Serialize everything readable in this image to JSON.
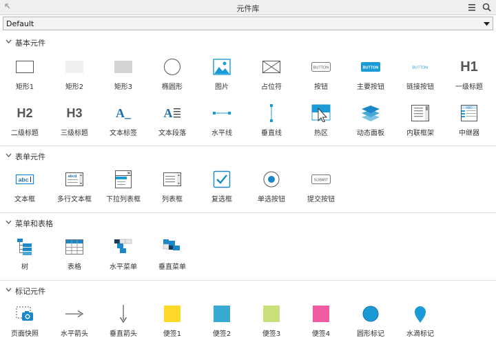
{
  "window": {
    "title": "元件库"
  },
  "library_select": {
    "value": "Default"
  },
  "sections": {
    "basic": {
      "title": "基本元件",
      "items": [
        "矩形1",
        "矩形2",
        "矩形3",
        "椭圆形",
        "图片",
        "占位符",
        "按钮",
        "主要按钮",
        "链接按钮",
        "一级标题",
        "二级标题",
        "三级标题",
        "文本标签",
        "文本段落",
        "水平线",
        "垂直线",
        "热区",
        "动态面板",
        "内联框架",
        "中继器"
      ]
    },
    "form": {
      "title": "表单元件",
      "items": [
        "文本框",
        "多行文本框",
        "下拉列表框",
        "列表框",
        "复选框",
        "单选按钮",
        "提交按钮"
      ]
    },
    "menu": {
      "title": "菜单和表格",
      "items": [
        "树",
        "表格",
        "水平菜单",
        "垂直菜单"
      ]
    },
    "markup": {
      "title": "标记元件",
      "items": [
        "页面快照",
        "水平箭头",
        "垂直箭头",
        "便签1",
        "便签2",
        "便签3",
        "便签4",
        "圆形标记",
        "水滴标记"
      ]
    }
  },
  "icon_text": {
    "button": "BUTTON",
    "primary_button": "BUTTON",
    "link_button": "BUTTON",
    "h1": "H1",
    "h2": "H2",
    "h3": "H3",
    "label": "A_",
    "paragraph": "A",
    "textbox": "abc",
    "textarea": "abcd",
    "submit": "SUBMIT",
    "repeater": "ABC"
  },
  "colors": {
    "accent": "#1a9bd7",
    "note1": "#ffd92a",
    "note2": "#38a9d2",
    "note3": "#c9df7c",
    "note4": "#ef5aa0"
  }
}
